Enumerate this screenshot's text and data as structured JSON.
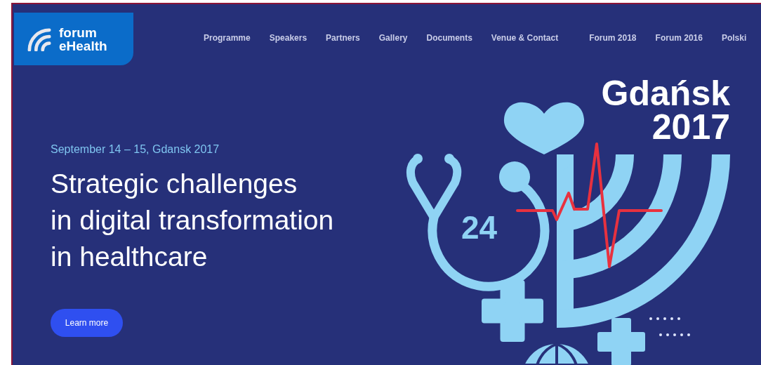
{
  "logo": {
    "line_1": "forum",
    "line_2": "eHealth"
  },
  "nav": {
    "links": [
      "Programme",
      "Speakers",
      "Partners",
      "Gallery",
      "Documents",
      "Venue & Contact"
    ],
    "editions": [
      "Forum 2018",
      "Forum 2016",
      "Polski"
    ]
  },
  "hero": {
    "date": "September 14 – 15, Gdansk 2017",
    "headline": "Strategic challenges\nin digital transformation\nin healthcare",
    "button": "Learn more"
  },
  "artwork": {
    "city": "Gdańsk",
    "year": "2017",
    "clock_number": "24"
  }
}
